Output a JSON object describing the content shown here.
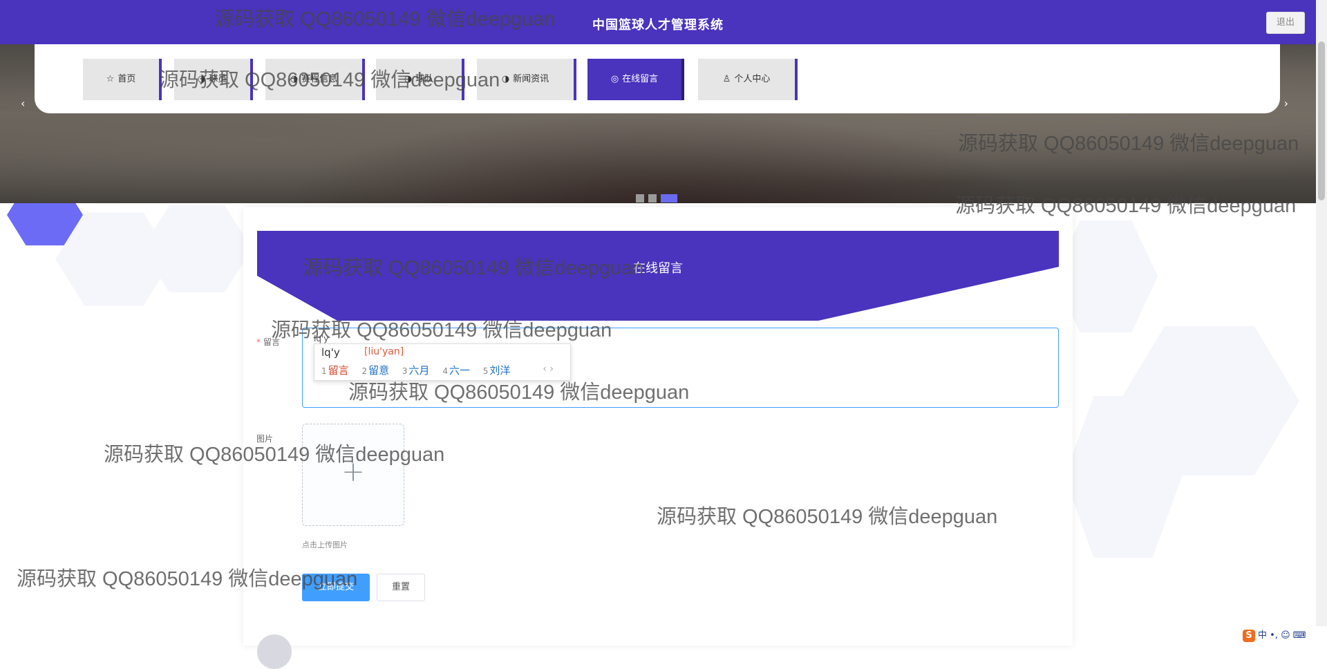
{
  "header": {
    "title": "中国篮球人才管理系统",
    "logout_label": "退出"
  },
  "banner": {
    "prev_arrow": "‹",
    "next_arrow": "›"
  },
  "nav": {
    "items": [
      {
        "label": "首页",
        "icon": "☆"
      },
      {
        "label": "球员",
        "icon": "◑"
      },
      {
        "label": "赛程信息",
        "icon": "◑"
      },
      {
        "label": "球队",
        "icon": "◑"
      },
      {
        "label": "新闻资讯",
        "icon": "◑"
      },
      {
        "label": "在线留言",
        "icon": "◎",
        "active": true
      },
      {
        "label": "个人中心",
        "icon": "♙"
      }
    ]
  },
  "form": {
    "title": "在线留言",
    "message_label": "留言",
    "required_mark": "*",
    "typed_text": "lq'y",
    "image_label": "图片",
    "upload_plus": "+",
    "upload_tip": "点击上传图片",
    "submit_label": "立即提交",
    "reset_label": "重置"
  },
  "ime": {
    "code": "lq'y",
    "pinyin": "[liu'yan]",
    "candidates": [
      {
        "n": "1",
        "text": "留言"
      },
      {
        "n": "2",
        "text": "留意"
      },
      {
        "n": "3",
        "text": "六月"
      },
      {
        "n": "4",
        "text": "六一"
      },
      {
        "n": "5",
        "text": "刘洋"
      }
    ],
    "nav": "‹ ›"
  },
  "watermark": "源码获取 QQ86050149 微信deepguan",
  "tray": {
    "s": "S",
    "text": "中 •, ☺ ⌨"
  },
  "colors": {
    "primary": "#4a33bd",
    "button_blue": "#409eff",
    "dot_active": "#6a6af0"
  }
}
